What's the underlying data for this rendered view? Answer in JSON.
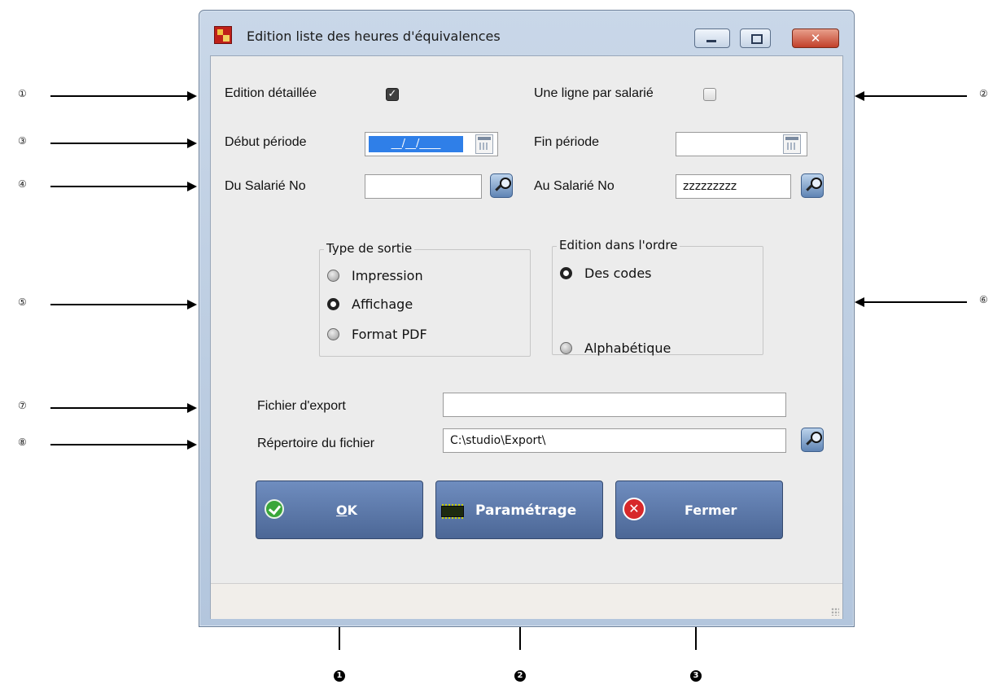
{
  "window": {
    "title": "Edition liste des heures d'équivalences",
    "minimize_glyph": "minimize",
    "maximize_glyph": "maximize",
    "close_glyph": "x"
  },
  "form": {
    "edition_detaillee": {
      "label": "Edition détaillée",
      "checked": true
    },
    "une_ligne_par_salarie": {
      "label": "Une ligne par salarié",
      "checked": false
    },
    "debut_periode": {
      "label": "Début période",
      "value": "__/__/____"
    },
    "fin_periode": {
      "label": "Fin période",
      "value": ""
    },
    "du_salarie": {
      "label": "Du Salarié No",
      "value": ""
    },
    "au_salarie": {
      "label": "Au Salarié No",
      "value": "zzzzzzzzz"
    },
    "type_sortie": {
      "legend": "Type de sortie",
      "options": [
        {
          "label": "Impression",
          "selected": false
        },
        {
          "label": "Affichage",
          "selected": true
        },
        {
          "label": "Format PDF",
          "selected": false
        }
      ]
    },
    "edition_ordre": {
      "legend": "Edition dans l'ordre",
      "options": [
        {
          "label": "Des codes",
          "selected": true
        },
        {
          "label": "Alphabétique",
          "selected": false
        }
      ]
    },
    "fichier_export": {
      "label": "Fichier d'export",
      "value": ""
    },
    "repertoire": {
      "label": "Répertoire du fichier",
      "value": "C:\\studio\\Export\\"
    }
  },
  "buttons": {
    "ok": {
      "mnemonic": "O",
      "rest": "K"
    },
    "parametrage": "Paramétrage",
    "fermer": "Fermer"
  },
  "callouts": {
    "left": [
      "①",
      "③",
      "④",
      "⑤",
      "⑦",
      "⑧"
    ],
    "right": [
      "②",
      "⑥"
    ],
    "bottom": [
      "1",
      "2",
      "3"
    ]
  },
  "colors": {
    "button_blue": "#5a78a8",
    "selection_blue": "#2f7fe8",
    "close_red": "#d7282a",
    "ok_green": "#3aa63a"
  }
}
